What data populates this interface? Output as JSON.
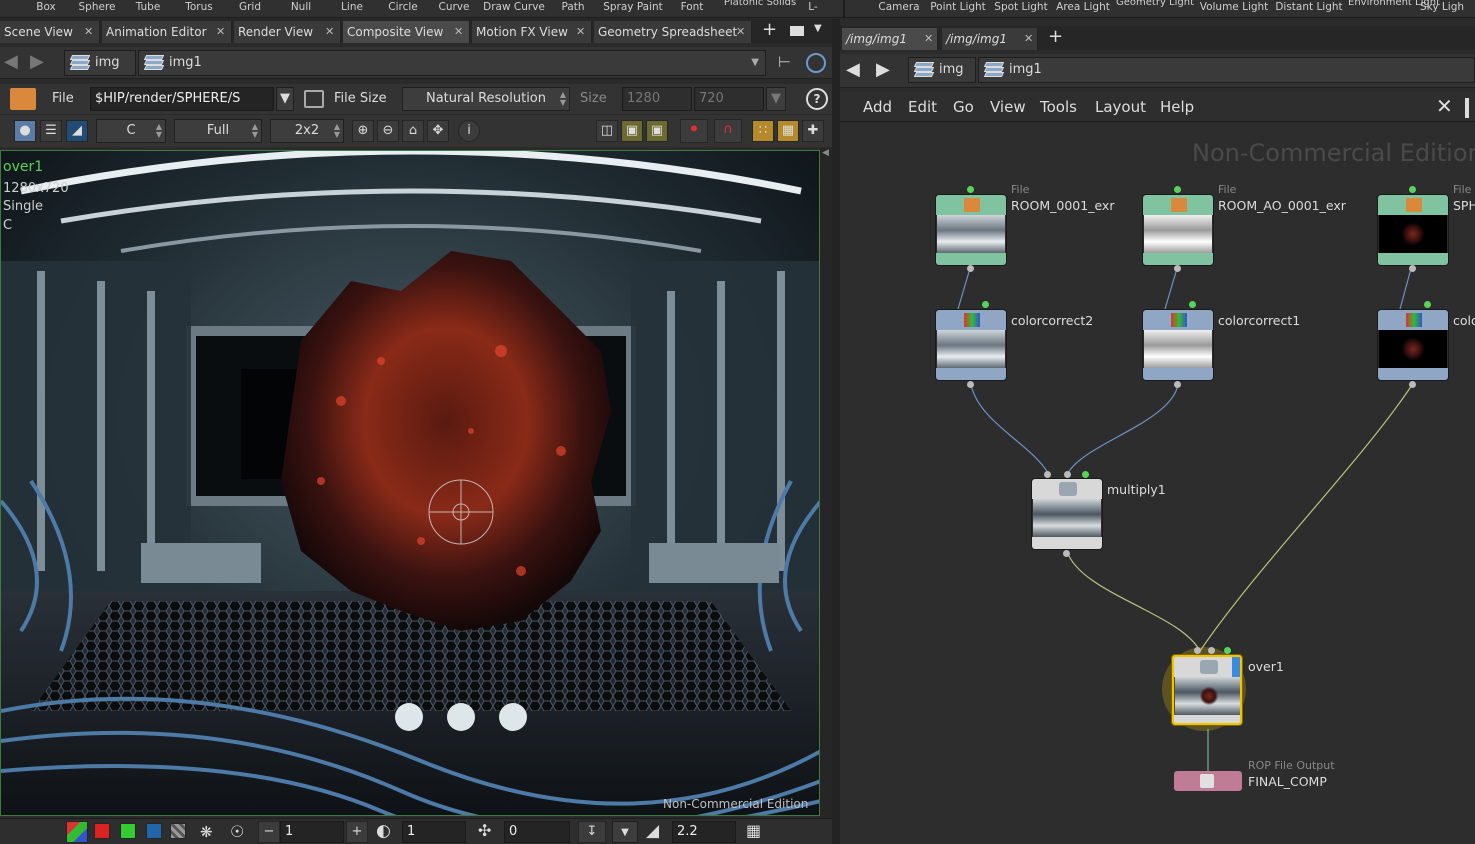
{
  "shelf": {
    "left_items": [
      "Box",
      "Sphere",
      "Tube",
      "Torus",
      "Grid",
      "Null",
      "Line",
      "Circle",
      "Curve",
      "Draw Curve",
      "Path",
      "Spray Paint",
      "Font",
      "Platonic Solids",
      "L-"
    ],
    "right_items": [
      "Camera",
      "Point Light",
      "Spot Light",
      "Area Light",
      "Geometry Light",
      "Volume Light",
      "Distant Light",
      "Environment Light",
      "Sky Ligh"
    ]
  },
  "left_tabs": [
    "Scene View",
    "Animation Editor",
    "Render View",
    "Composite View",
    "Motion FX View",
    "Geometry Spreadsheet"
  ],
  "left_active_tab": "Composite View",
  "left_path": {
    "crumb1": "img",
    "crumb2": "img1"
  },
  "file_row": {
    "file_label": "File",
    "file_value": "$HIP/render/SPHERE/S",
    "file_size_label": "File Size",
    "resolution_option": "Natural Resolution",
    "size_label": "Size",
    "size_w": "1280",
    "size_h": "720",
    "help": "?"
  },
  "view_row": {
    "channel": "C",
    "quality": "Full",
    "layout": "2x2"
  },
  "viewport": {
    "node_name": "over1",
    "resolution": "1280x720",
    "mode": "Single",
    "plane": "C",
    "watermark": "Non-Commercial Edition"
  },
  "bottom_bar": {
    "gain": "1",
    "gamma_offset": "1",
    "brightness": "0",
    "gamma": "2.2"
  },
  "right_tabs": [
    "/img/img1",
    "/img/img1"
  ],
  "right_path": {
    "crumb1": "img",
    "crumb2": "img1"
  },
  "network_menu": [
    "Add",
    "Edit",
    "Go",
    "View",
    "Tools",
    "Layout",
    "Help"
  ],
  "network": {
    "watermark": "Non-Commercial Edition",
    "nodes": [
      {
        "id": "file1",
        "type": "File",
        "name": "ROOM_0001_exr"
      },
      {
        "id": "file2",
        "type": "File",
        "name": "ROOM_AO_0001_exr"
      },
      {
        "id": "file3",
        "type": "File",
        "name": "SPH"
      },
      {
        "id": "cc2",
        "type": "",
        "name": "colorcorrect2"
      },
      {
        "id": "cc1",
        "type": "",
        "name": "colorcorrect1"
      },
      {
        "id": "cc3",
        "type": "",
        "name": "colo"
      },
      {
        "id": "mult",
        "type": "",
        "name": "multiply1"
      },
      {
        "id": "over",
        "type": "",
        "name": "over1"
      },
      {
        "id": "rop",
        "type": "ROP File Output",
        "name": "FINAL_COMP"
      }
    ]
  },
  "colors": {
    "file_node": "#7fc3a0",
    "cc_node": "#8fa6c4",
    "multiply_node": "#d8d8d8",
    "rop_node": "#c07b95",
    "selected": "#f0c400",
    "wire_blue": "#6d93c4",
    "wire_yellow": "#b9c47a"
  }
}
